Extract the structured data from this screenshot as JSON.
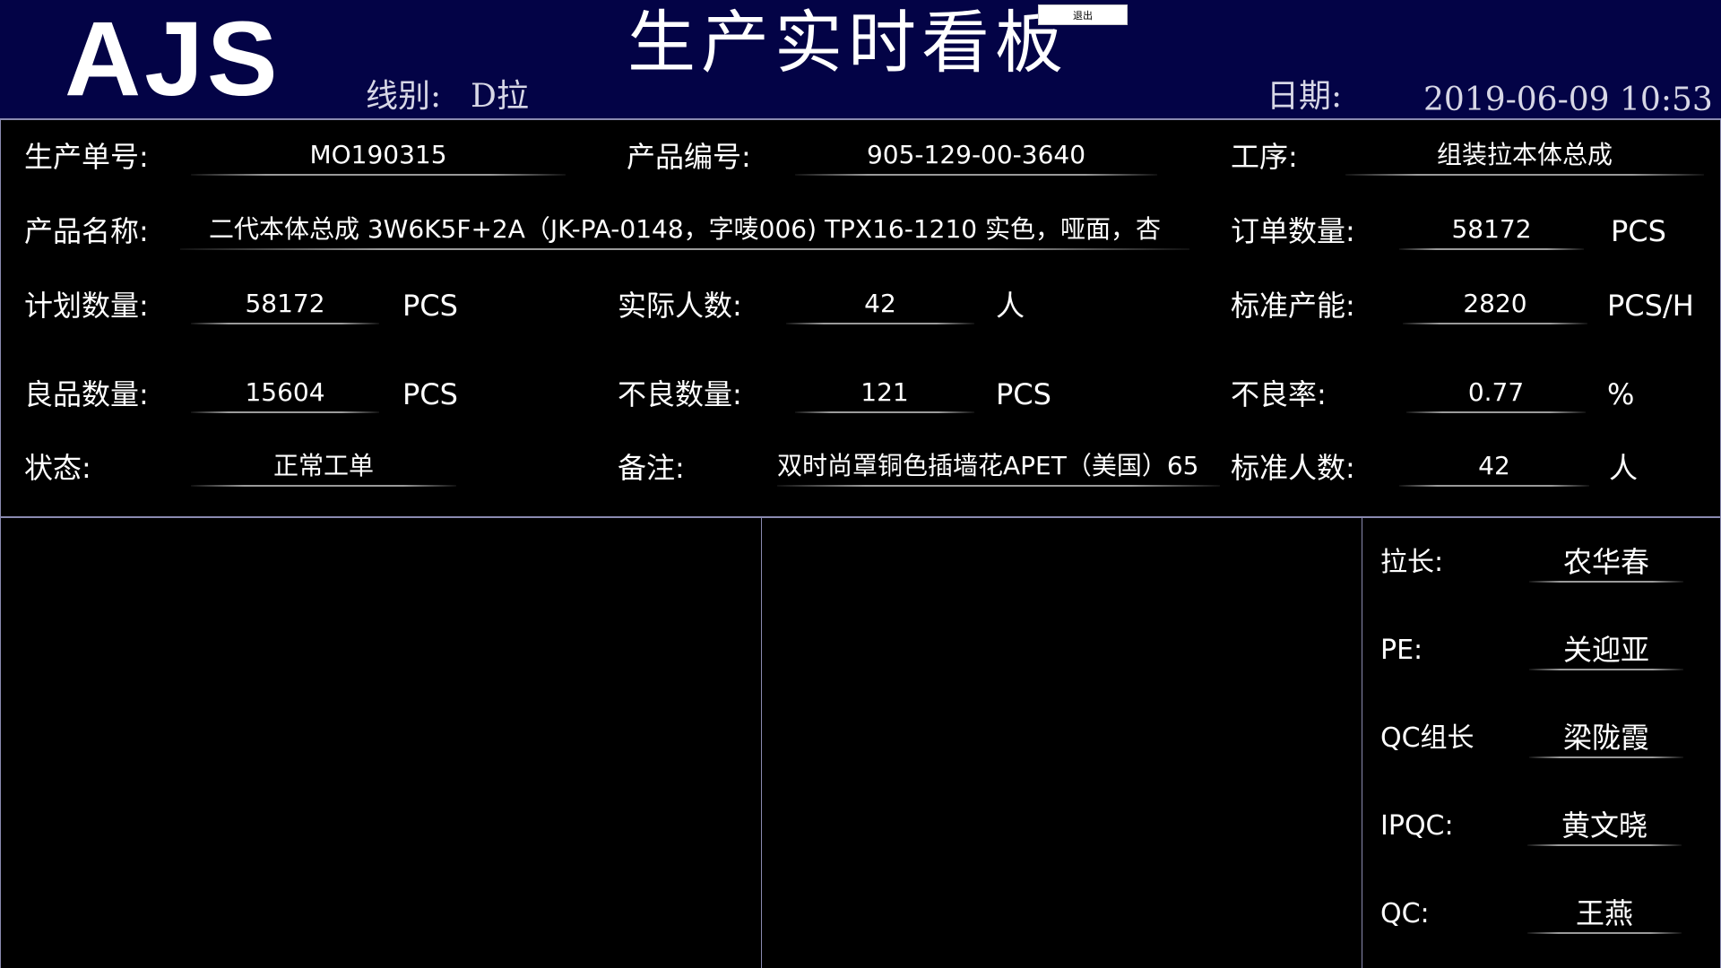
{
  "header": {
    "logo": "AJS",
    "title": "生产实时看板",
    "logout_label": "退出",
    "line_label": "线别:",
    "line_value": "D拉",
    "date_label": "日期:",
    "datetime": "2019-06-09 10:53"
  },
  "info": {
    "order_no": {
      "label": "生产单号:",
      "value": "MO190315"
    },
    "product_code": {
      "label": "产品编号:",
      "value": "905-129-00-3640"
    },
    "process": {
      "label": "工序:",
      "value": "组装拉本体总成"
    },
    "product_name": {
      "label": "产品名称:",
      "value": "二代本体总成 3W6K5F+2A（JK-PA-0148，字唛006) TPX16-1210 实色，哑面，杏"
    },
    "order_qty": {
      "label": "订单数量:",
      "value": "58172",
      "unit": "PCS"
    },
    "plan_qty": {
      "label": "计划数量:",
      "value": "58172",
      "unit": "PCS"
    },
    "actual_staff": {
      "label": "实际人数:",
      "value": "42",
      "unit": "人"
    },
    "std_capacity": {
      "label": "标准产能:",
      "value": "2820",
      "unit": "PCS/H"
    },
    "good_qty": {
      "label": "良品数量:",
      "value": "15604",
      "unit": "PCS"
    },
    "defect_qty": {
      "label": "不良数量:",
      "value": "121",
      "unit": "PCS"
    },
    "defect_rate": {
      "label": "不良率:",
      "value": "0.77",
      "unit": "%"
    },
    "status": {
      "label": "状态:",
      "value": "正常工单"
    },
    "remark": {
      "label": "备注:",
      "value": "双时尚罩铜色插墙花APET（美国）65"
    },
    "std_staff": {
      "label": "标准人数:",
      "value": "42",
      "unit": "人"
    }
  },
  "staff": [
    {
      "label": "拉长:",
      "value": "农华春"
    },
    {
      "label": "PE:",
      "value": "关迎亚"
    },
    {
      "label": "QC组长",
      "value": "梁陇霞"
    },
    {
      "label": "IPQC:",
      "value": "黄文晓"
    },
    {
      "label": "QC:",
      "value": "王燕"
    }
  ],
  "colors": {
    "header_bg": "#030346",
    "page_bg": "#000000",
    "text": "#ffffff",
    "border": "#8a8ab0"
  }
}
